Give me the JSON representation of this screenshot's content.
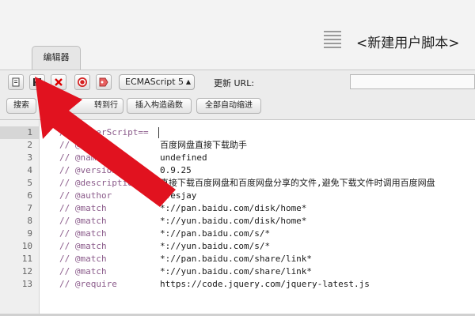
{
  "header": {
    "title": "<新建用户脚本>",
    "tab_label": "编辑器"
  },
  "toolbar": {
    "icons": [
      "page-icon",
      "save-icon",
      "delete-icon",
      "stop-icon",
      "tag-icon"
    ],
    "language": "ECMAScript 5",
    "update_label": "更新 URL:",
    "url_value": ""
  },
  "actions": {
    "search": "搜索",
    "goto_line": "转到行",
    "insert_constructor": "插入构造函数",
    "auto_indent": "全部自动缩进"
  },
  "editor": {
    "active_line": 1,
    "lines": [
      {
        "num": "1",
        "text": "// ==UserScript==",
        "val": ""
      },
      {
        "num": "2",
        "text": "// @name",
        "val": "百度网盘直接下载助手"
      },
      {
        "num": "3",
        "text": "// @namespace",
        "val": "undefined"
      },
      {
        "num": "4",
        "text": "// @version",
        "val": "0.9.25"
      },
      {
        "num": "5",
        "text": "// @description",
        "val": "直接下载百度网盘和百度网盘分享的文件,避免下载文件时调用百度网盘"
      },
      {
        "num": "6",
        "text": "// @author",
        "val": "ivesjay"
      },
      {
        "num": "7",
        "text": "// @match",
        "val": "*://pan.baidu.com/disk/home*"
      },
      {
        "num": "8",
        "text": "// @match",
        "val": "*://yun.baidu.com/disk/home*"
      },
      {
        "num": "9",
        "text": "// @match",
        "val": "*://pan.baidu.com/s/*"
      },
      {
        "num": "10",
        "text": "// @match",
        "val": "*://yun.baidu.com/s/*"
      },
      {
        "num": "11",
        "text": "// @match",
        "val": "*://pan.baidu.com/share/link*"
      },
      {
        "num": "12",
        "text": "// @match",
        "val": "*://yun.baidu.com/share/link*"
      },
      {
        "num": "13",
        "text": "// @require",
        "val": "https://code.jquery.com/jquery-latest.js"
      }
    ]
  },
  "annotation": {
    "arrow_color": "#e1121f"
  }
}
